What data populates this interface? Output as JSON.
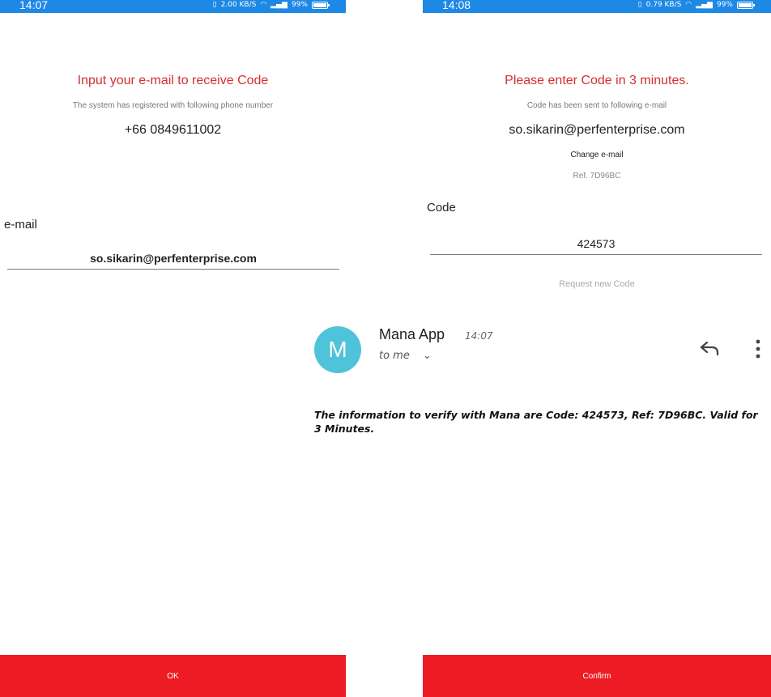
{
  "left_screen": {
    "status_time": "14:07",
    "status_net": "2.00 KB/S",
    "status_battery": "99%",
    "title": "Input your e-mail to receive Code",
    "subtitle": "The system has registered with following phone number",
    "phone": "+66 0849611002",
    "email_label": "e-mail",
    "email_value": "so.sikarin@perfenterprise.com",
    "ok_button": "OK"
  },
  "right_screen": {
    "status_time": "14:08",
    "status_net": "0.79 KB/S",
    "status_battery": "99%",
    "title": "Please enter Code in 3 minutes.",
    "subtitle": "Code has been sent to following e-mail",
    "email": "so.sikarin@perfenterprise.com",
    "change_email": "Change e-mail",
    "ref": "Ref. 7D96BC",
    "code_label": "Code",
    "code_value": "424573",
    "request_new": "Request new Code",
    "confirm_button": "Confirm"
  },
  "email_notification": {
    "avatar_letter": "M",
    "sender": "Mana App",
    "time": "14:07",
    "recipient": "to me",
    "body": "The information to verify with Mana are Code: 424573, Ref: 7D96BC. Valid for 3 Minutes."
  },
  "colors": {
    "status_bar": "#1e88e5",
    "title_red": "#d32f2f",
    "button_red": "#ed1c24",
    "avatar": "#4fc3d9"
  },
  "icons": {
    "reply": "reply-icon",
    "more": "more-vert-icon",
    "expand": "chevron-down-icon",
    "wifi": "wifi-icon",
    "signal": "signal-icon",
    "battery": "battery-icon",
    "vibrate": "vibrate-icon"
  }
}
